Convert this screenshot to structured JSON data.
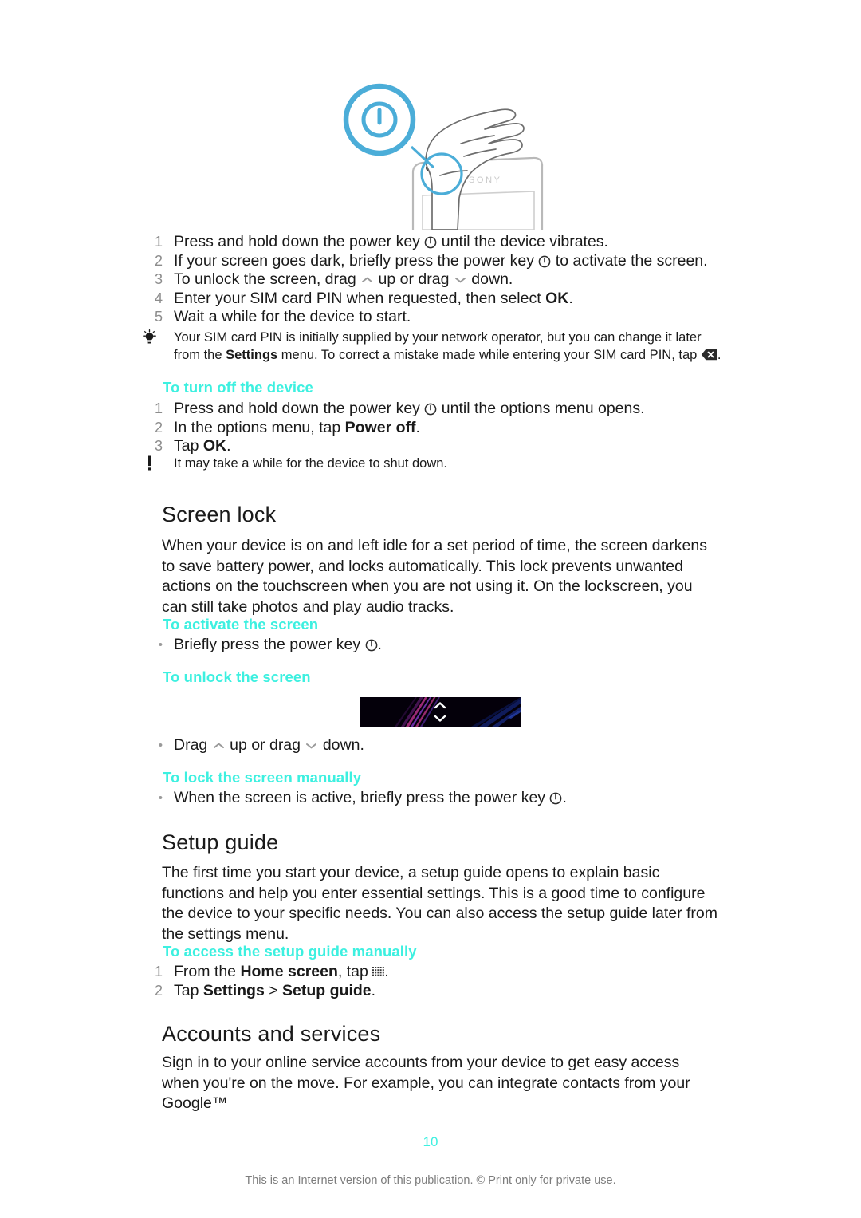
{
  "document": {
    "page_number": "10",
    "footer_note": "This is an Internet version of this publication. © Print only for private use."
  },
  "illustration": {
    "name": "hand-pressing-power-key-on-phone",
    "brand_text": "SONY",
    "callout_icon": "power-key-icon",
    "accent_color": "#4badd8"
  },
  "startup_steps": {
    "items": [
      {
        "num": "1",
        "pre": "Press and hold down the power key ",
        "icon": "power",
        "post": " until the device vibrates."
      },
      {
        "num": "2",
        "pre": "If your screen goes dark, briefly press the power key ",
        "icon": "power",
        "post": " to activate the screen."
      },
      {
        "num": "3",
        "pre": "To unlock the screen, drag ",
        "icon": "chevron-up",
        "mid": " up or drag ",
        "icon2": "chevron-down",
        "post": " down."
      },
      {
        "num": "4",
        "pre": "Enter your SIM card PIN when requested, then select ",
        "bold": "OK",
        "post": "."
      },
      {
        "num": "5",
        "pre": "Wait a while for the device to start.",
        "post": ""
      }
    ]
  },
  "tip_sim_pin": {
    "icon": "lightbulb-icon",
    "line1_a": "Your SIM card PIN is initially supplied by your network operator, but you can change it later",
    "line2_a": "from the ",
    "line2_bold": "Settings",
    "line2_b": " menu. To correct a mistake made while entering your SIM card PIN, tap ",
    "line2_icon": "backspace-icon",
    "line2_c": "."
  },
  "turn_off": {
    "heading": "To turn off the device",
    "steps": [
      {
        "num": "1",
        "pre": "Press and hold down the power key ",
        "icon": "power",
        "post": " until the options menu opens."
      },
      {
        "num": "2",
        "pre": "In the options menu, tap ",
        "bold": "Power off",
        "post": "."
      },
      {
        "num": "3",
        "pre": "Tap ",
        "bold": "OK",
        "post": "."
      }
    ],
    "note_icon": "exclamation-icon",
    "note_text": "It may take a while for the device to shut down."
  },
  "screen_lock": {
    "title": "Screen lock",
    "paragraph": "When your device is on and left idle for a set period of time, the screen darkens to save battery power, and locks automatically. This lock prevents unwanted actions on the touchscreen when you are not using it. On the lockscreen, you can still take photos and play audio tracks.",
    "activate_heading": "To activate the screen",
    "activate_bullet_pre": "Briefly press the power key ",
    "activate_bullet_icon": "power",
    "activate_bullet_post": ".",
    "unlock_heading": "To unlock the screen",
    "lockscreen_image": {
      "name": "lockscreen-preview",
      "background_color": "#04000a",
      "streak_colors": [
        "#d0379c",
        "#7c3fd8",
        "#2a3fc8",
        "#1b2a8a"
      ],
      "chevron_up_icon": "chevron-up-icon",
      "chevron_down_icon": "chevron-down-icon"
    },
    "unlock_bullet_pre": "Drag ",
    "unlock_bullet_icon1": "chevron-up",
    "unlock_bullet_mid": " up or drag ",
    "unlock_bullet_icon2": "chevron-down",
    "unlock_bullet_post": " down.",
    "lock_manually_heading": "To lock the screen manually",
    "lock_manually_pre": "When the screen is active, briefly press the power key ",
    "lock_manually_icon": "power",
    "lock_manually_post": "."
  },
  "setup_guide": {
    "title": "Setup guide",
    "paragraph": "The first time you start your device, a setup guide opens to explain basic functions and help you enter essential settings. This is a good time to configure the device to your specific needs. You can also access the setup guide later from the settings menu.",
    "access_heading": "To access the setup guide manually",
    "steps": [
      {
        "num": "1",
        "pre": "From the ",
        "bold": "Home screen",
        "mid": ", tap ",
        "icon": "app-grid",
        "post": "."
      },
      {
        "num": "2",
        "pre": "Tap ",
        "bold": "Settings",
        "mid": " > ",
        "bold2": "Setup guide",
        "post": "."
      }
    ]
  },
  "accounts": {
    "title": "Accounts and services",
    "paragraph": "Sign in to your online service accounts from your device to get easy access when you're on the move. For example, you can integrate contacts from your Google™"
  }
}
